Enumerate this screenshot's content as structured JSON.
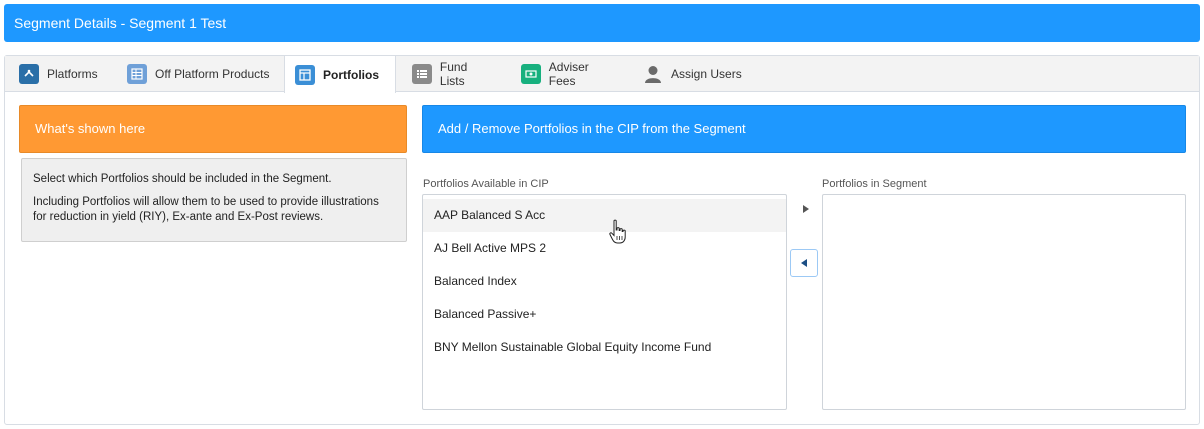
{
  "header": {
    "title": "Segment Details - Segment 1 Test"
  },
  "tabs": [
    {
      "label": "Platforms",
      "icon": "platforms-icon",
      "color": "#2a6fa8"
    },
    {
      "label": "Off Platform Products",
      "icon": "grid-table-icon",
      "color": "#6fa0d8"
    },
    {
      "label": "Portfolios",
      "icon": "portfolio-layout-icon",
      "color": "#3b8fd6",
      "active": true
    },
    {
      "label": "Fund Lists",
      "icon": "list-icon",
      "color": "#8a8a8a"
    },
    {
      "label": "Adviser Fees",
      "icon": "money-icon",
      "color": "#17b07e"
    },
    {
      "label": "Assign Users",
      "icon": "user-icon",
      "color": "#6a6a6a"
    }
  ],
  "sidebar": {
    "heading": "What's shown here",
    "paragraph1": "Select which Portfolios should be included in the Segment.",
    "paragraph2": "Including Portfolios will allow them to be used to provide illustrations for reduction in yield (RIY), Ex-ante and Ex-Post reviews."
  },
  "main": {
    "heading": "Add / Remove Portfolios in the CIP from the Segment",
    "available_label": "Portfolios Available in CIP",
    "segment_label": "Portfolios in Segment",
    "available_items": [
      "AAP Balanced S Acc",
      "AJ Bell Active MPS 2",
      "Balanced Index",
      "Balanced Passive+",
      "BNY Mellon Sustainable Global Equity Income Fund"
    ],
    "segment_items": []
  },
  "colors": {
    "accent": "#1e98ff",
    "orange": "#ff9933"
  }
}
